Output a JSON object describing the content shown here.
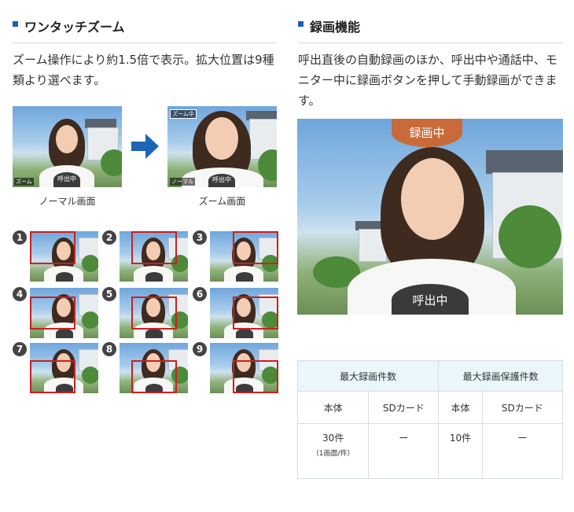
{
  "left": {
    "title": "ワンタッチズーム",
    "description": "ズーム操作により約1.5倍で表示。拡大位置は9種類より選べます。",
    "normal_caption": "ノーマル画面",
    "zoom_caption": "ズーム画面",
    "zoom_tag": "ズーム",
    "call_tag": "呼出中",
    "zoom_active_tag": "ズーム中",
    "normal_tag": "ノーマル",
    "numbers": [
      "1",
      "2",
      "3",
      "4",
      "5",
      "6",
      "7",
      "8",
      "9"
    ]
  },
  "right": {
    "title": "録画機能",
    "description": "呼出直後の自動録画のほか、呼出中や通話中、モニター中に録画ボタンを押して手動録画ができます。",
    "recording_badge": "録画中",
    "calling_badge": "呼出中"
  },
  "table": {
    "headers": [
      "最大録画件数",
      "最大録画保護件数"
    ],
    "subheaders": [
      "本体",
      "SDカード",
      "本体",
      "SDカード"
    ],
    "row": {
      "c1": "30件",
      "c1_note": "（1画面/件）",
      "c2": "ー",
      "c3": "10件",
      "c4": "ー"
    }
  },
  "colors": {
    "accent": "#1a5fb4",
    "zoom_frame": "#cc1f1f",
    "rec_badge": "#c96a3b",
    "table_header": "#eaf6fa"
  }
}
